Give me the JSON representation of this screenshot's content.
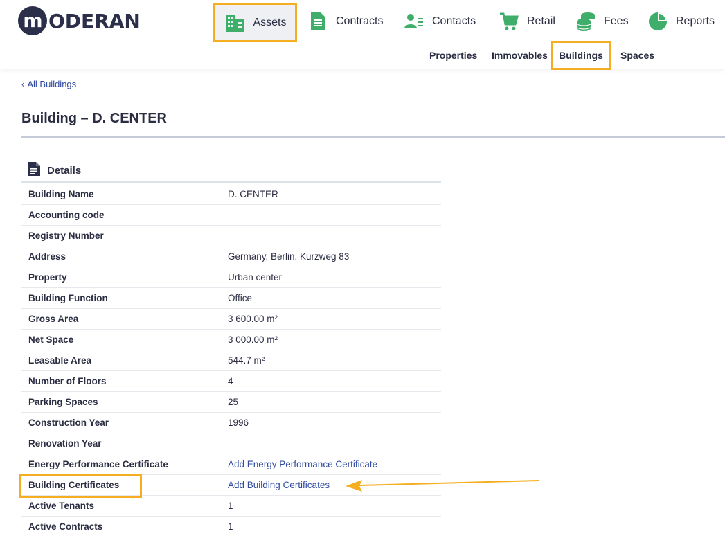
{
  "brand": {
    "logo_letter": "m",
    "logo_text": "ODERAN"
  },
  "nav": {
    "assets": "Assets",
    "contracts": "Contracts",
    "contacts": "Contacts",
    "retail": "Retail",
    "fees": "Fees",
    "reports": "Reports"
  },
  "subnav": {
    "properties": "Properties",
    "immovables": "Immovables",
    "buildings": "Buildings",
    "spaces": "Spaces"
  },
  "back_link": "All Buildings",
  "page_title": "Building – D. CENTER",
  "section_title": "Details",
  "rows": [
    {
      "label": "Building Name",
      "value": "D. CENTER"
    },
    {
      "label": "Accounting code",
      "value": ""
    },
    {
      "label": "Registry Number",
      "value": ""
    },
    {
      "label": "Address",
      "value": "Germany, Berlin, Kurzweg 83"
    },
    {
      "label": "Property",
      "value": "Urban center"
    },
    {
      "label": "Building Function",
      "value": "Office"
    },
    {
      "label": "Gross Area",
      "value": "3 600.00 m²"
    },
    {
      "label": "Net Space",
      "value": "3 000.00 m²"
    },
    {
      "label": "Leasable Area",
      "value": "544.7 m²"
    },
    {
      "label": "Number of Floors",
      "value": "4"
    },
    {
      "label": "Parking Spaces",
      "value": "25"
    },
    {
      "label": "Construction Year",
      "value": "1996"
    },
    {
      "label": "Renovation Year",
      "value": ""
    },
    {
      "label": "Energy Performance Certificate",
      "value": "Add Energy Performance Certificate"
    },
    {
      "label": "Building Certificates",
      "value": "Add Building Certificates"
    },
    {
      "label": "Active Tenants",
      "value": "1"
    },
    {
      "label": "Active Contracts",
      "value": "1"
    }
  ],
  "colors": {
    "brand_dark": "#2b2f4a",
    "icon_green": "#3fae6a",
    "highlight": "#f5ae21",
    "link": "#2f4aa0"
  }
}
